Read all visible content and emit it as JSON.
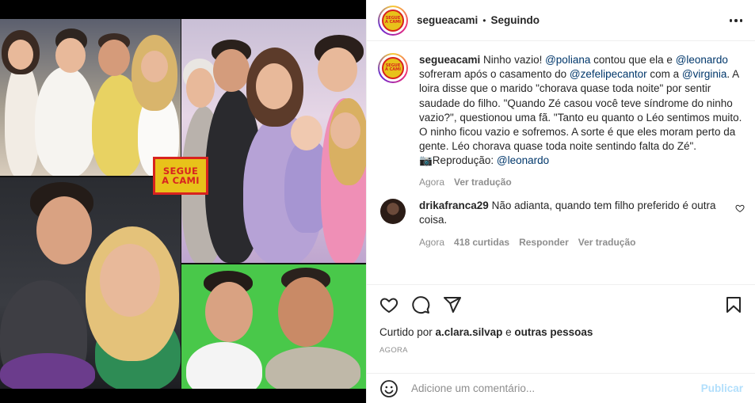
{
  "header": {
    "username": "segueacami",
    "separator": "•",
    "follow_status": "Seguindo",
    "avatar_text_1": "SEGUE",
    "avatar_text_2": "A CAMI"
  },
  "media": {
    "stamp_line_1": "SEGUE",
    "stamp_line_2": "A CAMI"
  },
  "caption": {
    "username": "segueacami",
    "part1": " Ninho vazio! ",
    "mention1": "@poliana",
    "part2": " contou que ela e ",
    "mention2": "@leonardo",
    "part3": " sofreram após o casamento do ",
    "mention3": "@zefelipecantor",
    "part4": " com a ",
    "mention4": "@virginia",
    "part5": ". A loira disse que o marido \"chorava quase toda noite\" por sentir saudade do filho. \"Quando Zé casou você teve síndrome do ninho vazio?\", questionou uma fã. \"Tanto eu quanto o Léo sentimos muito. O ninho ficou vazio e sofremos. A sorte é que eles moram perto da gente. Léo chorava quase toda noite sentindo falta do Zé\".",
    "credit_prefix": "📷Reprodução: ",
    "credit_mention": "@leonardo",
    "time": "Agora",
    "translate": "Ver tradução"
  },
  "comment": {
    "username": "drikafranca29",
    "text": " Não adianta, quando tem filho preferido é outra coisa.",
    "time": "Agora",
    "likes": "418 curtidas",
    "reply": "Responder",
    "translate": "Ver tradução"
  },
  "actions": {
    "icons": [
      "heart-icon",
      "comment-icon",
      "share-icon",
      "bookmark-icon"
    ],
    "liked_prefix": "Curtido por ",
    "liked_user": "a.clara.silvap",
    "liked_mid": " e ",
    "liked_others": "outras pessoas",
    "timestamp": "AGORA"
  },
  "add_comment": {
    "placeholder": "Adicione um comentário...",
    "publish": "Publicar"
  },
  "colors": {
    "mention": "#00376b",
    "muted": "#8e8e8e",
    "publish_disabled": "#b2dffc",
    "brand_yellow": "#e8c21a",
    "brand_red": "#d8231f"
  }
}
